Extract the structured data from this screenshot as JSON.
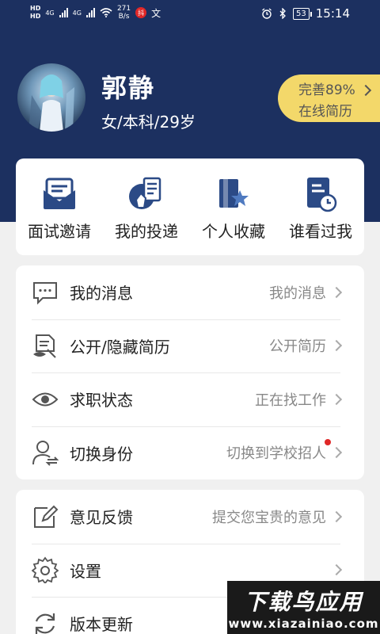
{
  "status_bar": {
    "sim1": "HD",
    "sim2": "HD",
    "net1": "4G",
    "net2": "4G",
    "speed_value": "271",
    "speed_unit": "B/s",
    "app_badge": "抖",
    "input_badge": "文",
    "battery": "53",
    "time": "15:14"
  },
  "profile": {
    "name": "郭静",
    "subtitle": "女/本科/29岁",
    "completion_line1": "完善89%",
    "completion_line2": "在线简历"
  },
  "quick_actions": [
    {
      "label": "面试邀请",
      "icon": "envelope-icon"
    },
    {
      "label": "我的投递",
      "icon": "resume-hand-icon"
    },
    {
      "label": "个人收藏",
      "icon": "book-star-icon"
    },
    {
      "label": "谁看过我",
      "icon": "document-clock-icon"
    }
  ],
  "menu_primary": [
    {
      "label": "我的消息",
      "value": "我的消息",
      "icon": "message-bubble-icon"
    },
    {
      "label": "公开/隐藏简历",
      "value": "公开简历",
      "icon": "resume-toggle-icon"
    },
    {
      "label": "求职状态",
      "value": "正在找工作",
      "icon": "status-eye-icon"
    },
    {
      "label": "切换身份",
      "value": "切换到学校招人",
      "icon": "user-switch-icon"
    }
  ],
  "menu_secondary": [
    {
      "label": "意见反馈",
      "value": "提交您宝贵的意见",
      "icon": "edit-icon"
    },
    {
      "label": "设置",
      "value": "",
      "icon": "gear-icon"
    },
    {
      "label": "版本更新",
      "value": "",
      "icon": "refresh-icon"
    }
  ],
  "watermark": {
    "line1": "下载鸟应用",
    "line2": "www.xiazainiao.com"
  },
  "colors": {
    "header": "#1c3060",
    "accent_yellow": "#f3d86a",
    "icon_blue": "#2b4a86",
    "notification_red": "#e02828"
  }
}
